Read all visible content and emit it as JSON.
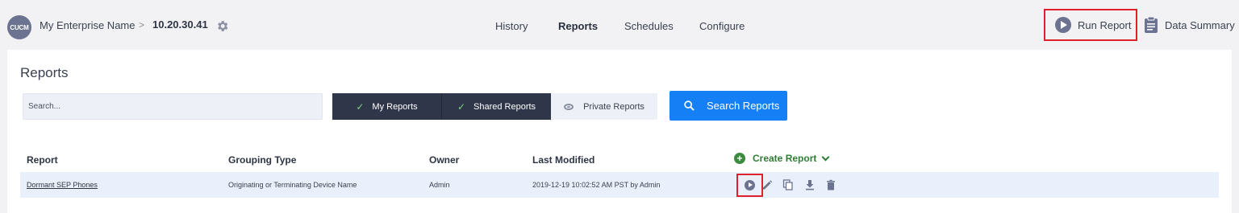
{
  "header": {
    "avatar_text": "CUCM",
    "enterprise": "My Enterprise Name",
    "separator": ">",
    "ip": "10.20.30.41",
    "nav": [
      "History",
      "Reports",
      "Schedules",
      "Configure"
    ],
    "active_nav": "Reports",
    "run_report": "Run Report",
    "data_summary": "Data Summary"
  },
  "main": {
    "title": "Reports",
    "search_placeholder": "Search...",
    "filters": {
      "my_reports": "My Reports",
      "shared_reports": "Shared Reports",
      "private_reports": "Private Reports"
    },
    "search_button": "Search Reports",
    "create_report": "Create Report"
  },
  "table": {
    "columns": [
      "Report",
      "Grouping Type",
      "Owner",
      "Last Modified"
    ],
    "rows": [
      {
        "report": "Dormant SEP Phones",
        "grouping_type": "Originating or Terminating Device Name",
        "owner": "Admin",
        "last_modified": "2019-12-19 10:02:52 AM PST by Admin"
      }
    ]
  },
  "icons": {
    "settings": "gear-icon",
    "run": "play-icon",
    "summary": "clipboard-icon",
    "search": "search-icon",
    "row_actions": [
      "play-icon",
      "edit-icon",
      "copy-icon",
      "download-icon",
      "delete-icon"
    ]
  },
  "colors": {
    "accent": "#1580f5",
    "dark_toggle": "#2f3649",
    "highlight": "#e0202a",
    "create": "#2e7d32"
  }
}
